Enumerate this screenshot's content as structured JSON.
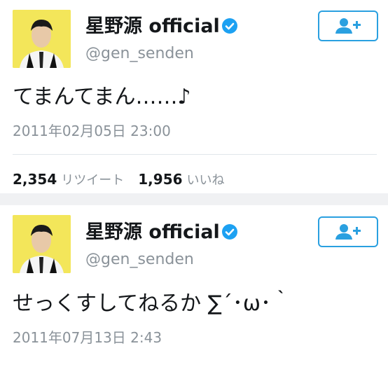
{
  "tweets": [
    {
      "display_name": "星野源 official",
      "handle": "@gen_senden",
      "text": "てまんてまん……♪",
      "timestamp": "2011年02月05日 23:00",
      "retweets": "2,354",
      "retweets_label": "リツイート",
      "likes": "1,956",
      "likes_label": "いいね"
    },
    {
      "display_name": "星野源 official",
      "handle": "@gen_senden",
      "text": "せっくすしてねるか ∑´･ω･｀",
      "timestamp": "2011年07月13日 2:43"
    }
  ],
  "colors": {
    "accent": "#2aa0e0",
    "verified": "#1da1f2",
    "avatar_bg": "#f3e65a",
    "secondary_text": "#8a9299"
  },
  "icons": {
    "verified": "verified-badge-icon",
    "follow": "follow-user-plus-icon"
  }
}
